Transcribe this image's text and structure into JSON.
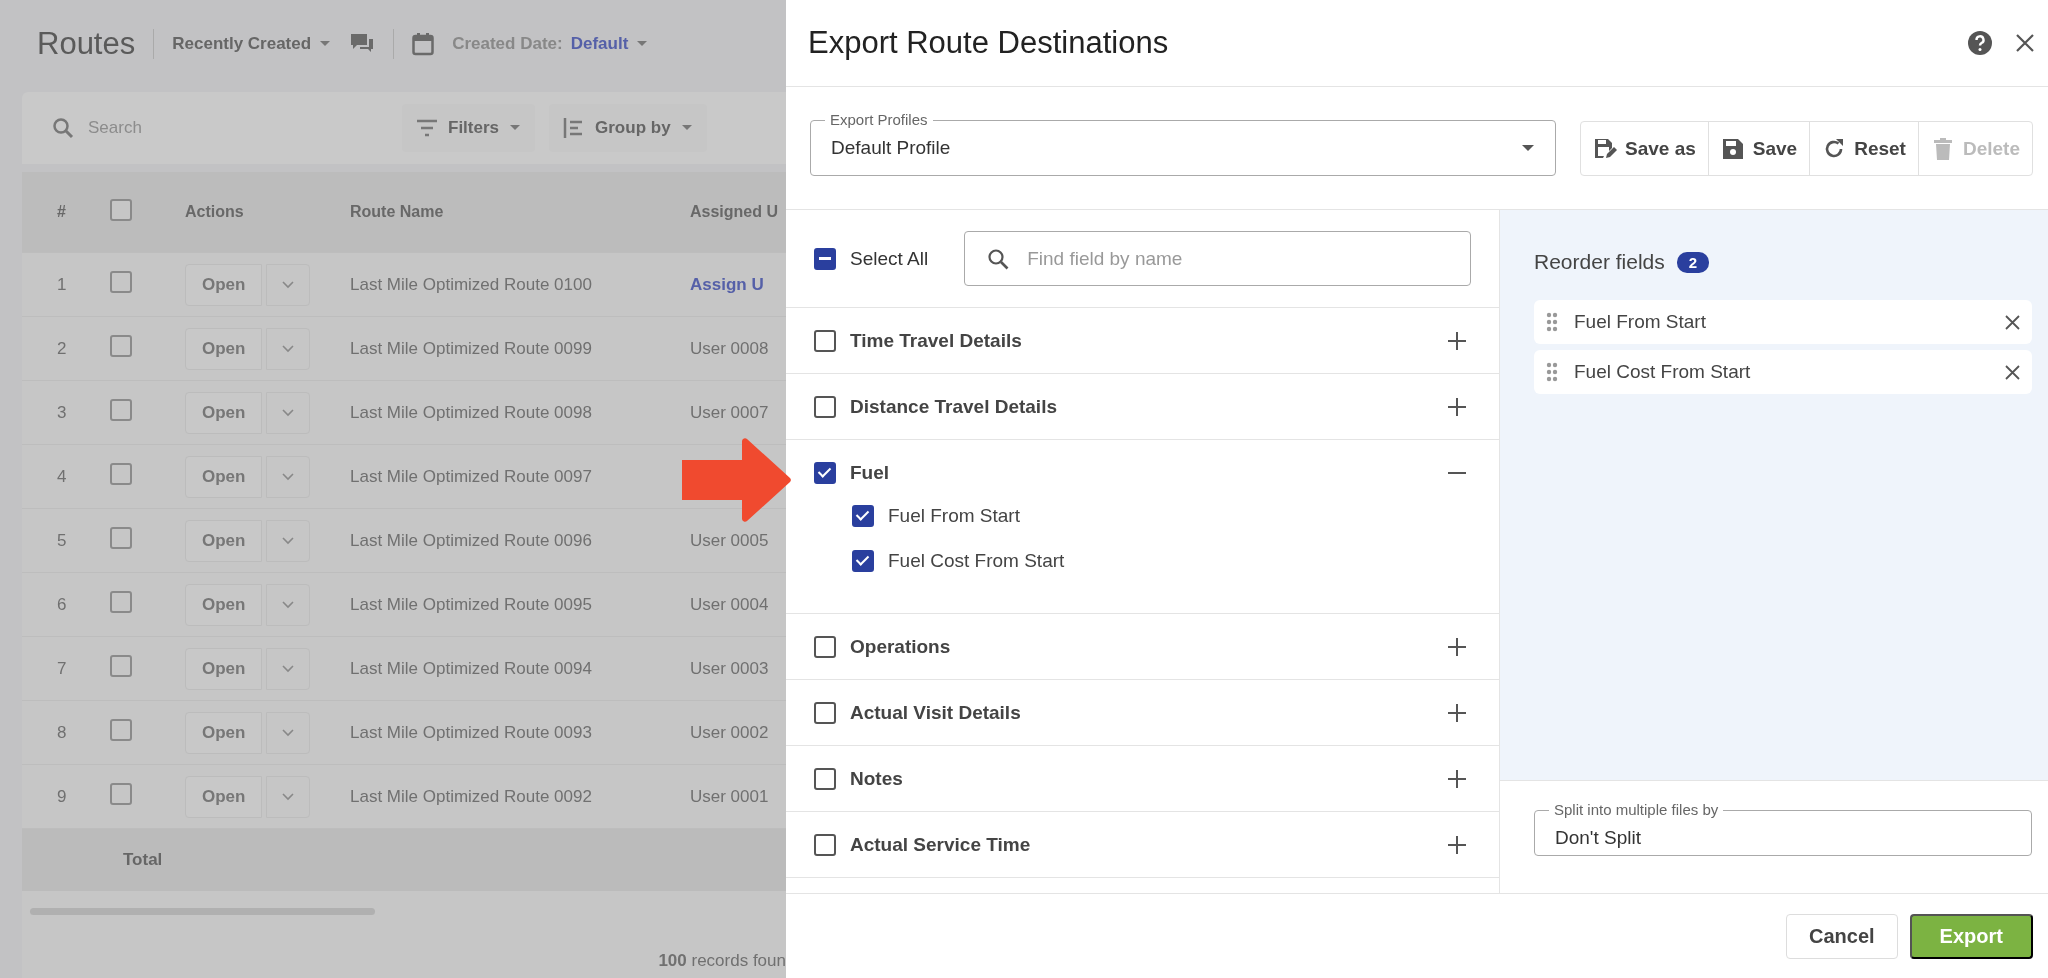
{
  "background_page": {
    "title": "Routes",
    "view_menu": "Recently Created",
    "date_filter": {
      "label": "Created Date:",
      "value": "Default"
    },
    "search": {
      "placeholder": "Search"
    },
    "filters_button": "Filters",
    "group_by_button": "Group by",
    "table": {
      "columns": [
        "#",
        "Actions",
        "Route Name",
        "Assigned U"
      ],
      "header_checked": false,
      "rows": [
        {
          "number": "1",
          "checked": false,
          "action": "Open",
          "route_name": "Last Mile Optimized Route 0100",
          "assigned": "Assign U",
          "kind": "link"
        },
        {
          "number": "2",
          "checked": false,
          "action": "Open",
          "route_name": "Last Mile Optimized Route 0099",
          "assigned": "User 0008",
          "kind": "text"
        },
        {
          "number": "3",
          "checked": false,
          "action": "Open",
          "route_name": "Last Mile Optimized Route 0098",
          "assigned": "User 0007",
          "kind": "text"
        },
        {
          "number": "4",
          "checked": false,
          "action": "Open",
          "route_name": "Last Mile Optimized Route 0097"
        },
        {
          "number": "5",
          "checked": false,
          "action": "Open",
          "route_name": "Last Mile Optimized Route 0096",
          "assigned": "User 0005",
          "kind": "text"
        },
        {
          "number": "6",
          "checked": false,
          "action": "Open",
          "route_name": "Last Mile Optimized Route 0095",
          "assigned": "User 0004",
          "kind": "text"
        },
        {
          "number": "7",
          "checked": false,
          "action": "Open",
          "route_name": "Last Mile Optimized Route 0094",
          "assigned": "User 0003",
          "kind": "text"
        },
        {
          "number": "8",
          "checked": false,
          "action": "Open",
          "route_name": "Last Mile Optimized Route 0093",
          "assigned": "User 0002",
          "kind": "text"
        },
        {
          "number": "9",
          "checked": false,
          "action": "Open",
          "route_name": "Last Mile Optimized Route 0092",
          "assigned": "User 0001",
          "kind": "text"
        }
      ],
      "total_label": "Total"
    },
    "records": "**100** records foun"
  },
  "dialog": {
    "title": "Export Route Destinations",
    "export_profile": {
      "label": "Export Profiles",
      "value": "Default Profile"
    },
    "profile_actions": [
      {
        "label": "Save as",
        "kind": "save-as",
        "disabled": false
      },
      {
        "label": "Save",
        "kind": "save",
        "disabled": false
      },
      {
        "label": "Reset",
        "kind": "reset",
        "disabled": false
      },
      {
        "label": "Delete",
        "kind": "delete",
        "disabled": true
      }
    ],
    "select_all": {
      "label": "Select All",
      "indeterminate": true
    },
    "field_search": {
      "placeholder": "Find field by name"
    },
    "field_groups": [
      {
        "label": "Time Travel Details",
        "checked": false,
        "expanded": false
      },
      {
        "label": "Distance Travel Details",
        "checked": false,
        "expanded": false
      },
      {
        "label": "Fuel",
        "checked": true,
        "expanded": true,
        "children": [
          {
            "label": "Fuel From Start",
            "checked": true
          },
          {
            "label": "Fuel Cost From Start",
            "checked": true
          }
        ]
      },
      {
        "label": "Operations",
        "checked": false,
        "expanded": false
      },
      {
        "label": "Actual Visit Details",
        "checked": false,
        "expanded": false
      },
      {
        "label": "Notes",
        "checked": false,
        "expanded": false
      },
      {
        "label": "Actual Service Time",
        "checked": false,
        "expanded": false
      }
    ],
    "reorder": {
      "title": "Reorder fields",
      "count": "2",
      "items": [
        "Fuel From Start",
        "Fuel Cost From Start"
      ]
    },
    "split": {
      "label": "Split into multiple files by",
      "value": "Don't Split"
    },
    "buttons": [
      {
        "label": "Cancel",
        "kind": "secondary"
      },
      {
        "label": "Export",
        "kind": "primary"
      }
    ]
  }
}
